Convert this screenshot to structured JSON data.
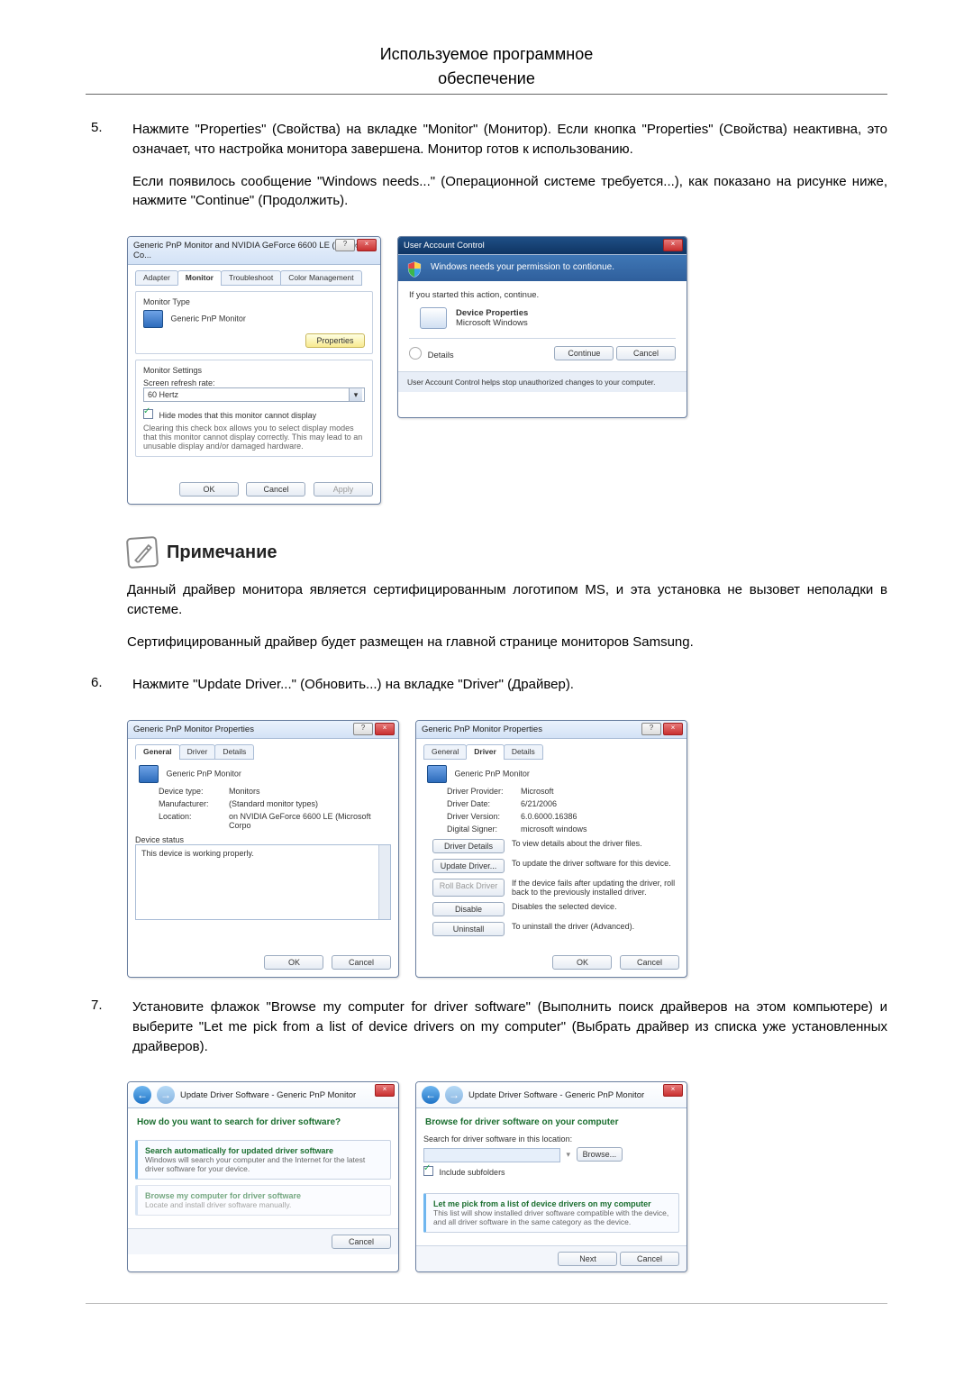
{
  "header": {
    "line1": "Используемое программное",
    "line2": "обеспечение"
  },
  "step5": {
    "num": "5.",
    "p1": "Нажмите \"Properties\" (Свойства) на вкладке \"Monitor\" (Монитор). Если кнопка \"Properties\" (Свойства) неактивна, это означает, что настройка монитора завершена. Монитор готов к использованию.",
    "p2": "Если появилось сообщение \"Windows needs...\" (Операционной системе требуется...), как показано на рисунке ниже, нажмите \"Continue\" (Продолжить)."
  },
  "monitorDlg": {
    "title": "Generic PnP Monitor and NVIDIA GeForce 6600 LE (Microsoft Co...",
    "tabs": [
      "Adapter",
      "Monitor",
      "Troubleshoot",
      "Color Management"
    ],
    "typeLabel": "Monitor Type",
    "typeVal": "Generic PnP Monitor",
    "propBtn": "Properties",
    "settingsLabel": "Monitor Settings",
    "refreshLabel": "Screen refresh rate:",
    "refreshVal": "60 Hertz",
    "hideChk": "Hide modes that this monitor cannot display",
    "hideHelp": "Clearing this check box allows you to select display modes that this monitor cannot display correctly. This may lead to an unusable display and/or damaged hardware.",
    "ok": "OK",
    "cancel": "Cancel",
    "apply": "Apply"
  },
  "uac": {
    "title": "User Account Control",
    "banner": "Windows needs your permission to contionue.",
    "started": "If you started this action, continue.",
    "devName": "Device Properties",
    "devPub": "Microsoft Windows",
    "details": "Details",
    "continue": "Continue",
    "cancel": "Cancel",
    "foot": "User Account Control helps stop unauthorized changes to your computer."
  },
  "note": {
    "title": "Примечание",
    "p1": "Данный драйвер монитора является сертифицированным логотипом MS, и эта установка не вызовет неполадки в системе.",
    "p2": "Сертифицированный драйвер будет размещен на главной странице мониторов Samsung."
  },
  "step6": {
    "num": "6.",
    "p1": "Нажмите \"Update Driver...\" (Обновить...) на вкладке \"Driver\" (Драйвер)."
  },
  "pnpGeneral": {
    "title": "Generic PnP Monitor Properties",
    "tabs": [
      "General",
      "Driver",
      "Details"
    ],
    "name": "Generic PnP Monitor",
    "kv": {
      "type_l": "Device type:",
      "type_v": "Monitors",
      "mfr_l": "Manufacturer:",
      "mfr_v": "(Standard monitor types)",
      "loc_l": "Location:",
      "loc_v": "on NVIDIA GeForce 6600 LE (Microsoft Corpo"
    },
    "statusLabel": "Device status",
    "statusText": "This device is working properly.",
    "ok": "OK",
    "cancel": "Cancel"
  },
  "pnpDriver": {
    "title": "Generic PnP Monitor Properties",
    "tabs": [
      "General",
      "Driver",
      "Details"
    ],
    "name": "Generic PnP Monitor",
    "kv": {
      "prov_l": "Driver Provider:",
      "prov_v": "Microsoft",
      "date_l": "Driver Date:",
      "date_v": "6/21/2006",
      "ver_l": "Driver Version:",
      "ver_v": "6.0.6000.16386",
      "sig_l": "Digital Signer:",
      "sig_v": "microsoft windows"
    },
    "btns": {
      "det": {
        "l": "Driver Details",
        "d": "To view details about the driver files."
      },
      "upd": {
        "l": "Update Driver...",
        "d": "To update the driver software for this device."
      },
      "roll": {
        "l": "Roll Back Driver",
        "d": "If the device fails after updating the driver, roll back to the previously installed driver."
      },
      "dis": {
        "l": "Disable",
        "d": "Disables the selected device."
      },
      "un": {
        "l": "Uninstall",
        "d": "To uninstall the driver (Advanced)."
      }
    },
    "ok": "OK",
    "cancel": "Cancel"
  },
  "step7": {
    "num": "7.",
    "p1": "Установите флажок \"Browse my computer for driver software\" (Выполнить поиск драйверов на этом компьютере) и выберите \"Let me pick from a list of device drivers on my computer\" (Выбрать драйвер из списка уже установленных драйверов)."
  },
  "wizA": {
    "crumb": "Update Driver Software - Generic PnP Monitor",
    "q": "How do you want to search for driver software?",
    "opt1t": "Search automatically for updated driver software",
    "opt1s": "Windows will search your computer and the Internet for the latest driver software for your device.",
    "opt2t": "Browse my computer for driver software",
    "opt2s": "Locate and install driver software manually.",
    "cancel": "Cancel"
  },
  "wizB": {
    "crumb": "Update Driver Software - Generic PnP Monitor",
    "q": "Browse for driver software on your computer",
    "searchLabel": "Search for driver software in this location:",
    "browse": "Browse...",
    "includeSub": "Include subfolders",
    "opt1t": "Let me pick from a list of device drivers on my computer",
    "opt1s": "This list will show installed driver software compatible with the device, and all driver software in the same category as the device.",
    "next": "Next",
    "cancel": "Cancel"
  }
}
